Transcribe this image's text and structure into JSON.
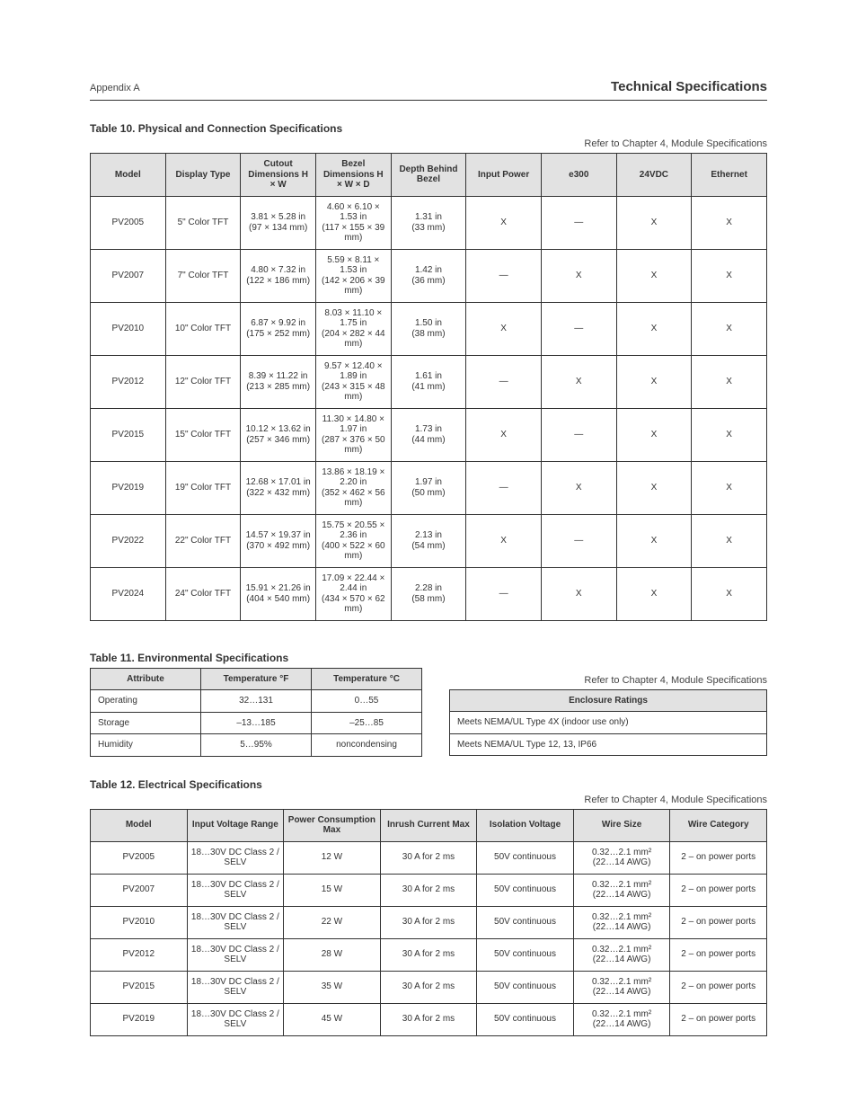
{
  "header": {
    "left": "Appendix A",
    "right": "Technical Specifications"
  },
  "t10": {
    "title": "Table 10. Physical and Connection Specifications",
    "ref": "Refer to Chapter 4, Module Specifications",
    "cols": [
      "Model",
      "Display Type",
      "Cutout Dimensions H × W",
      "Bezel Dimensions H × W × D",
      "Depth Behind Bezel",
      "Input Power",
      "e300",
      "24VDC",
      "Ethernet"
    ],
    "rows": [
      [
        "PV2005",
        "5\" Color TFT",
        "3.81 × 5.28 in\n(97 × 134 mm)",
        "4.60 × 6.10 × 1.53 in\n(117 × 155 × 39 mm)",
        "1.31 in\n(33 mm)",
        "X",
        "—",
        "X",
        "X"
      ],
      [
        "PV2007",
        "7\" Color TFT",
        "4.80 × 7.32 in\n(122 × 186 mm)",
        "5.59 × 8.11 × 1.53 in\n(142 × 206 × 39 mm)",
        "1.42 in\n(36 mm)",
        "—",
        "X",
        "X",
        "X"
      ],
      [
        "PV2010",
        "10\" Color TFT",
        "6.87 × 9.92 in\n(175 × 252 mm)",
        "8.03 × 11.10 × 1.75 in\n(204 × 282 × 44 mm)",
        "1.50 in\n(38 mm)",
        "X",
        "—",
        "X",
        "X"
      ],
      [
        "PV2012",
        "12\" Color TFT",
        "8.39 × 11.22 in\n(213 × 285 mm)",
        "9.57 × 12.40 × 1.89 in\n(243 × 315 × 48 mm)",
        "1.61 in\n(41 mm)",
        "—",
        "X",
        "X",
        "X"
      ],
      [
        "PV2015",
        "15\" Color TFT",
        "10.12 × 13.62 in\n(257 × 346 mm)",
        "11.30 × 14.80 × 1.97 in\n(287 × 376 × 50 mm)",
        "1.73 in\n(44 mm)",
        "X",
        "—",
        "X",
        "X"
      ],
      [
        "PV2019",
        "19\" Color TFT",
        "12.68 × 17.01 in\n(322 × 432 mm)",
        "13.86 × 18.19 × 2.20 in\n(352 × 462 × 56 mm)",
        "1.97 in\n(50 mm)",
        "—",
        "X",
        "X",
        "X"
      ],
      [
        "PV2022",
        "22\" Color TFT",
        "14.57 × 19.37 in\n(370 × 492 mm)",
        "15.75 × 20.55 × 2.36 in\n(400 × 522 × 60 mm)",
        "2.13 in\n(54 mm)",
        "X",
        "—",
        "X",
        "X"
      ],
      [
        "PV2024",
        "24\" Color TFT",
        "15.91 × 21.26 in\n(404 × 540 mm)",
        "17.09 × 22.44 × 2.44 in\n(434 × 570 × 62 mm)",
        "2.28 in\n(58 mm)",
        "—",
        "X",
        "X",
        "X"
      ]
    ]
  },
  "t11": {
    "title": "Table 11. Environmental Specifications",
    "ref": "Refer to Chapter 4, Module Specifications",
    "cols": [
      "Attribute",
      "Temperature °F",
      "Temperature °C"
    ],
    "rows": [
      [
        "Operating",
        "32…131",
        "0…55"
      ],
      [
        "Storage",
        "–13…185",
        "–25…85"
      ],
      [
        "Humidity",
        "5…95%",
        "noncondensing"
      ]
    ]
  },
  "t11b": {
    "cols": [
      "Enclosure Ratings"
    ],
    "rows": [
      [
        "Meets NEMA/UL Type 4X (indoor use only)"
      ],
      [
        "Meets NEMA/UL Type 12, 13, IP66"
      ]
    ]
  },
  "t12": {
    "title": "Table 12. Electrical Specifications",
    "ref": "Refer to Chapter 4, Module Specifications",
    "cols": [
      "Model",
      "Input Voltage Range",
      "Power Consumption Max",
      "Inrush Current Max",
      "Isolation Voltage",
      "Wire Size",
      "Wire Category"
    ],
    "rows": [
      [
        "PV2005",
        "18…30V DC Class 2 / SELV",
        "12 W",
        "30 A for 2 ms",
        "50V continuous",
        "0.32…2.1 mm²\n(22…14 AWG)",
        "2 – on power ports"
      ],
      [
        "PV2007",
        "18…30V DC Class 2 / SELV",
        "15 W",
        "30 A for 2 ms",
        "50V continuous",
        "0.32…2.1 mm²\n(22…14 AWG)",
        "2 – on power ports"
      ],
      [
        "PV2010",
        "18…30V DC Class 2 / SELV",
        "22 W",
        "30 A for 2 ms",
        "50V continuous",
        "0.32…2.1 mm²\n(22…14 AWG)",
        "2 – on power ports"
      ],
      [
        "PV2012",
        "18…30V DC Class 2 / SELV",
        "28 W",
        "30 A for 2 ms",
        "50V continuous",
        "0.32…2.1 mm²\n(22…14 AWG)",
        "2 – on power ports"
      ],
      [
        "PV2015",
        "18…30V DC Class 2 / SELV",
        "35 W",
        "30 A for 2 ms",
        "50V continuous",
        "0.32…2.1 mm²\n(22…14 AWG)",
        "2 – on power ports"
      ],
      [
        "PV2019",
        "18…30V DC Class 2 / SELV",
        "45 W",
        "30 A for 2 ms",
        "50V continuous",
        "0.32…2.1 mm²\n(22…14 AWG)",
        "2 – on power ports"
      ]
    ]
  }
}
